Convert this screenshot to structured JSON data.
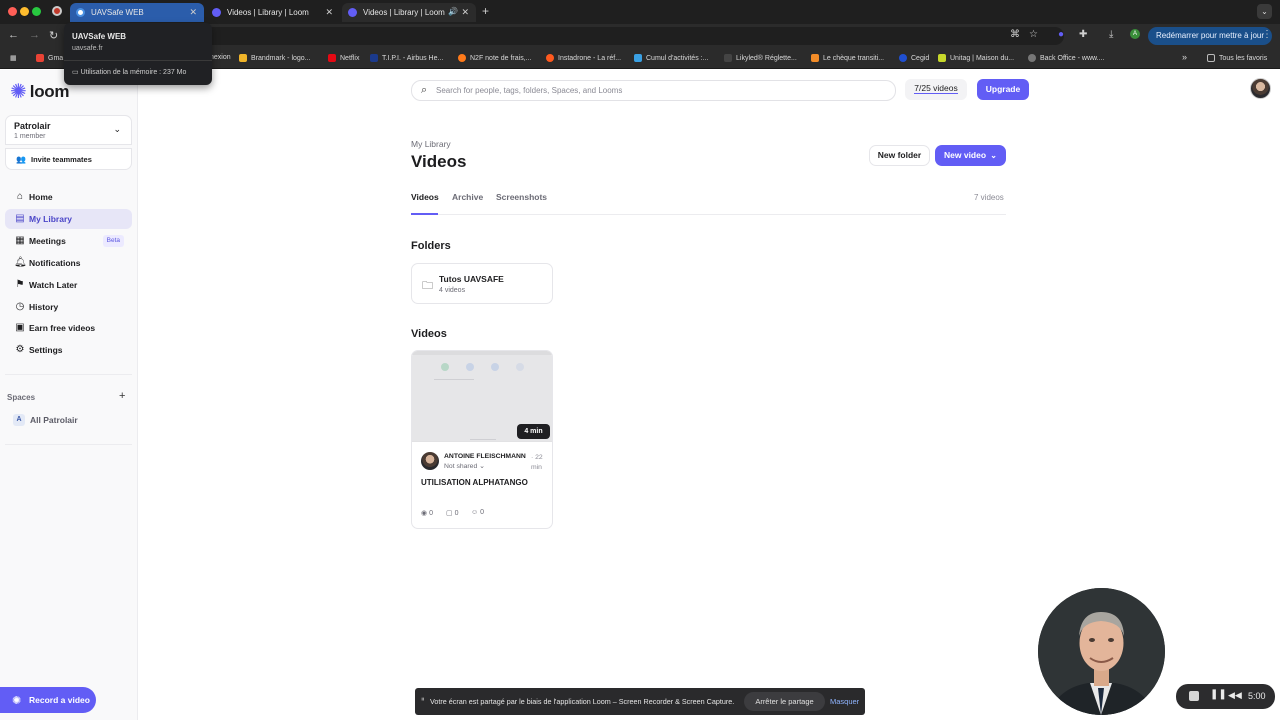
{
  "browser": {
    "tabs": [
      {
        "title": "UAVSafe WEB",
        "active": true
      },
      {
        "title": "Videos | Library | Loom",
        "active": false
      },
      {
        "title": "Videos | Library | Loom",
        "active": false,
        "audio": true
      }
    ],
    "update_button": "Redémarrer pour mettre à jour",
    "tooltip": {
      "title": "UAVSafe WEB",
      "url": "uavsafe.fr",
      "memory": "Utilisation de la mémoire : 237 Mo"
    },
    "bookmarks": [
      {
        "label": "Gma",
        "color": "#ea4335"
      },
      {
        "label": "nexion",
        "color": "#555555"
      },
      {
        "label": "Brandmark - logo...",
        "color": "#f0b429"
      },
      {
        "label": "Netflix",
        "color": "#e50914"
      },
      {
        "label": "T.I.P.I. - Airbus He...",
        "color": "#1b3a8c"
      },
      {
        "label": "N2F note de frais,...",
        "color": "#ff7a1a"
      },
      {
        "label": "Instadrone - La réf...",
        "color": "#ff5a1f"
      },
      {
        "label": "Cumul d'activités :...",
        "color": "#3aa0e3"
      },
      {
        "label": "Likyled® Réglette...",
        "color": "#444444"
      },
      {
        "label": "Le chèque transiti...",
        "color": "#f28c28"
      },
      {
        "label": "Cegid",
        "color": "#1f4fd1"
      },
      {
        "label": "Unitag | Maison du...",
        "color": "#c7d82b"
      },
      {
        "label": "Back Office - www....",
        "color": "#777777"
      }
    ],
    "bookmarks_more": "»",
    "all_bookmarks": "Tous les favoris"
  },
  "sidebar": {
    "logo": "loom",
    "workspace_name": "Patrolair",
    "workspace_members": "1 member",
    "invite": "Invite teammates",
    "nav": [
      {
        "label": "Home",
        "icon": "home-icon",
        "glyph": "⌂",
        "active": false
      },
      {
        "label": "My Library",
        "icon": "library-icon",
        "glyph": "▤",
        "active": true
      },
      {
        "label": "Meetings",
        "icon": "calendar-icon",
        "glyph": "▦",
        "active": false,
        "badge": "Beta"
      },
      {
        "label": "Notifications",
        "icon": "bell-icon",
        "glyph": "♫",
        "active": false
      },
      {
        "label": "Watch Later",
        "icon": "bookmark-icon",
        "glyph": "⚑",
        "active": false
      },
      {
        "label": "History",
        "icon": "history-icon",
        "glyph": "◷",
        "active": false
      },
      {
        "label": "Earn free videos",
        "icon": "gift-icon",
        "glyph": "▣",
        "active": false
      },
      {
        "label": "Settings",
        "icon": "gear-icon",
        "glyph": "⚙",
        "active": false
      }
    ],
    "spaces_title": "Spaces",
    "space_badge": "A",
    "space_name": "All Patrolair",
    "record_label": "Record a video"
  },
  "topbar": {
    "search_placeholder": "Search for people, tags, folders, Spaces, and Looms",
    "quota": "7/25 videos",
    "upgrade": "Upgrade"
  },
  "library": {
    "breadcrumb": "My Library",
    "title": "Videos",
    "new_folder": "New folder",
    "new_video": "New video",
    "tabs": [
      "Videos",
      "Archive",
      "Screenshots"
    ],
    "video_count": "7 videos",
    "folders_title": "Folders",
    "folder": {
      "name": "Tutos UAVSAFE",
      "count": "4 videos"
    },
    "videos_title": "Videos",
    "video": {
      "duration": "4 min",
      "owner": "ANTOINE FLEISCHMANN",
      "time": "· 22 min",
      "sharing": "Not shared",
      "title": "UTILISATION ALPHATANGO",
      "views": "0",
      "comments": "0",
      "reactions": "0"
    }
  },
  "screen_share": {
    "message": "Votre écran est partagé par le biais de l'application Loom – Screen Recorder & Screen Capture.",
    "stop": "Arrêter le partage",
    "hide": "Masquer"
  },
  "recorder": {
    "time": "5:00"
  },
  "colors": {
    "accent": "#625df5",
    "tab_active": "#2b5dab"
  }
}
